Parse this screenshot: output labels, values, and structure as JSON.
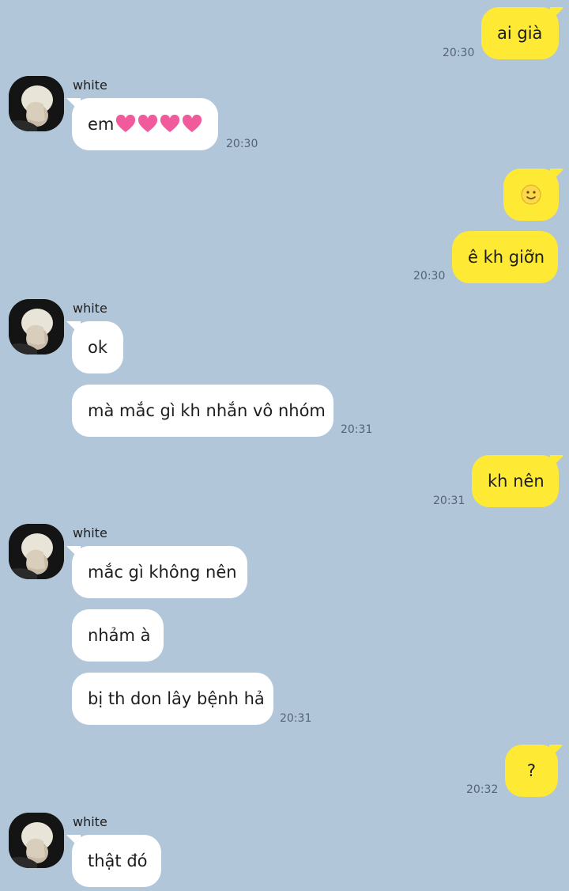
{
  "contact": {
    "name": "white"
  },
  "colors": {
    "background": "#b2c6da",
    "my_bubble": "#fee934",
    "their_bubble": "#ffffff",
    "timestamp": "#556474"
  },
  "messages": [
    {
      "sender": "me",
      "text": "ai già",
      "time": "20:30"
    },
    {
      "sender": "white",
      "text": "em",
      "emoji": [
        "heart-icon",
        "heart-icon",
        "heart-icon",
        "heart-icon"
      ],
      "time": "20:30"
    },
    {
      "sender": "me",
      "emoji": [
        "slightly-smiling-face-icon"
      ]
    },
    {
      "sender": "me",
      "text": "ê kh giỡn",
      "time": "20:30"
    },
    {
      "sender": "white",
      "text": "ok"
    },
    {
      "sender": "white",
      "text": "mà mắc gì kh nhắn vô nhóm",
      "time": "20:31"
    },
    {
      "sender": "me",
      "text": "kh nên",
      "time": "20:31"
    },
    {
      "sender": "white",
      "text": "mắc gì không nên"
    },
    {
      "sender": "white",
      "text": "nhảm à"
    },
    {
      "sender": "white",
      "text": "bị th don lây bệnh hả",
      "time": "20:31"
    },
    {
      "sender": "me",
      "text": "?",
      "time": "20:32"
    },
    {
      "sender": "white",
      "text": "thật đó"
    }
  ]
}
